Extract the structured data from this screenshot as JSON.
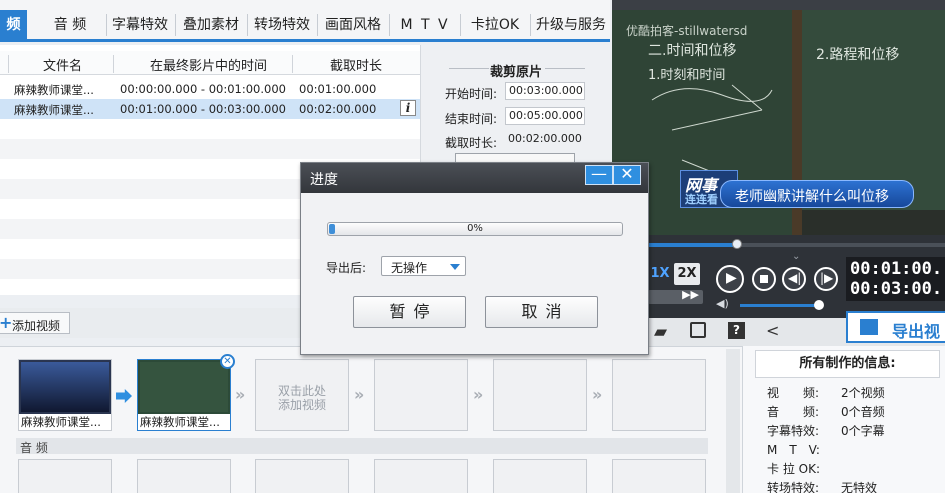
{
  "tabs": [
    {
      "label": "频",
      "active": true
    },
    {
      "label": "音 频"
    },
    {
      "label": "字幕特效"
    },
    {
      "label": "叠加素材"
    },
    {
      "label": "转场特效"
    },
    {
      "label": "画面风格"
    },
    {
      "label": "M T V"
    },
    {
      "label": "卡拉OK"
    },
    {
      "label": "升级与服务"
    }
  ],
  "table": {
    "headers": [
      "文件名",
      "在最终影片中的时间",
      "截取时长"
    ],
    "rows": [
      {
        "name": "麻辣教师课堂...",
        "range": "00:00:00.000 - 00:01:00.000",
        "duration": "00:01:00.000",
        "selected": false
      },
      {
        "name": "麻辣教师课堂...",
        "range": "00:01:00.000 - 00:03:00.000",
        "duration": "00:02:00.000",
        "selected": true
      }
    ],
    "info_icon": "i"
  },
  "trim": {
    "title": "裁剪原片",
    "start_label": "开始时间:",
    "start_value": "00:03:00.000",
    "end_label": "结束时间:",
    "end_value": "00:05:00.000",
    "dur_label": "截取时长:",
    "dur_value": "00:02:00.000"
  },
  "video": {
    "watermark": "优酷拍客-stillwatersd",
    "board_text_1": "二.时间和位移",
    "board_text_2": "1.时刻和时间",
    "board_text_3": "2.路程和位移",
    "logo_line1": "网事",
    "logo_line2": "连连看",
    "caption": "老师幽默讲解什么叫位移"
  },
  "player": {
    "speed_1x": "1X",
    "speed_2x": "2X",
    "time_current": "00:01:00.",
    "time_total": "00:03:00.",
    "export_label": "导出视"
  },
  "add_video_label": "添加视频",
  "timeline": {
    "clip1_label": "麻辣教师课堂...",
    "clip2_label": "麻辣教师课堂...",
    "placeholder_line1": "双击此处",
    "placeholder_line2": "添加视频",
    "audio_label": "音 频"
  },
  "info": {
    "title": "所有制作的信息:",
    "lines": [
      {
        "k": "视　　频:",
        "v": "2个视频"
      },
      {
        "k": "音　　频:",
        "v": "0个音频"
      },
      {
        "k": "字幕特效:",
        "v": "0个字幕"
      },
      {
        "k": "M　T　V:",
        "v": ""
      },
      {
        "k": "卡 拉 OK:",
        "v": ""
      },
      {
        "k": "转场特效:",
        "v": "无特效"
      }
    ]
  },
  "modal": {
    "title": "进度",
    "progress_text": "0%",
    "progress_value": 0.02,
    "after_label": "导出后:",
    "after_value": "无操作",
    "pause_label": "暂停",
    "cancel_label": "取消",
    "minimize_glyph": "—",
    "close_glyph": "✕"
  },
  "colors": {
    "accent": "#2a7fd0",
    "selected_row": "#cfe3f7",
    "caption_bg": "#1f5fb8"
  }
}
